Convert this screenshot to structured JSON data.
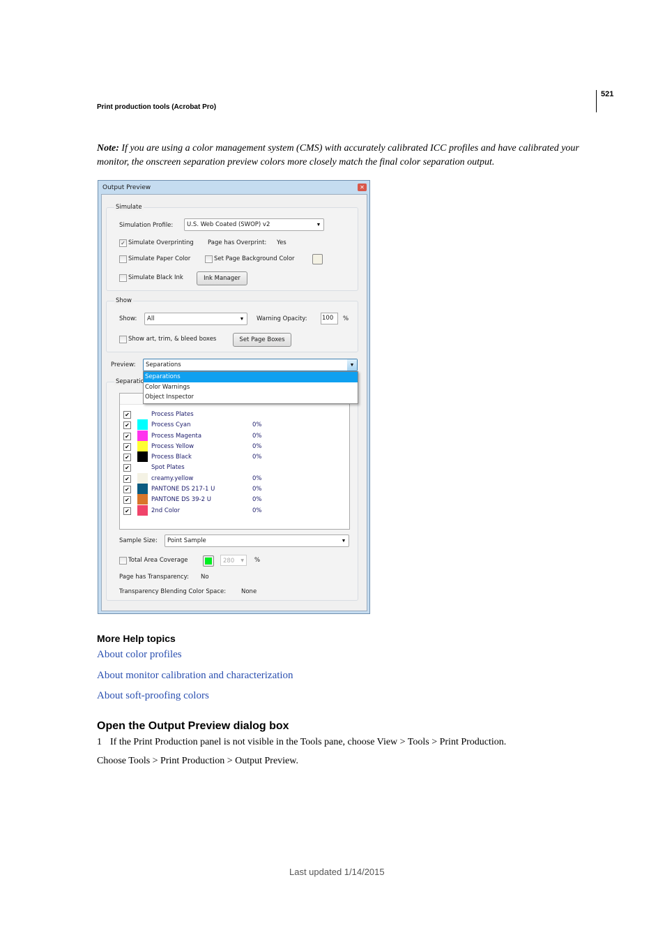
{
  "header": {
    "section": "Print production tools (Acrobat Pro)",
    "page_number": "521"
  },
  "note": {
    "label": "Note:",
    "text": " If you are using a color management system (CMS) with accurately calibrated ICC profiles and have calibrated your monitor, the onscreen separation preview colors more closely match the final color separation output."
  },
  "dialog": {
    "title": "Output Preview",
    "simulate": {
      "legend": "Simulate",
      "profile_label": "Simulation Profile:",
      "profile_value": "U.S. Web Coated (SWOP) v2",
      "overprinting": "Simulate Overprinting",
      "overprint_label": "Page has Overprint:",
      "overprint_value": "Yes",
      "paper_color": "Simulate Paper Color",
      "bg_color": "Set Page Background Color",
      "black_ink": "Simulate Black Ink",
      "ink_manager": "Ink Manager"
    },
    "show": {
      "legend": "Show",
      "show_label": "Show:",
      "show_value": "All",
      "opacity_label": "Warning Opacity:",
      "opacity_value": "100",
      "pct": "%",
      "boxes": "Show art, trim, & bleed boxes",
      "set_boxes": "Set Page Boxes"
    },
    "preview": {
      "label": "Preview:",
      "value": "Separations",
      "options": [
        "Separations",
        "Color Warnings",
        "Object Inspector"
      ],
      "selected": "Separations"
    },
    "separations": {
      "legend": "Separations",
      "rows": [
        {
          "name": "Process Plates",
          "color": null,
          "pct": ""
        },
        {
          "name": "Process Cyan",
          "color": "#00ffff",
          "pct": "0%"
        },
        {
          "name": "Process Magenta",
          "color": "#ff33ee",
          "pct": "0%"
        },
        {
          "name": "Process Yellow",
          "color": "#ffff33",
          "pct": "0%"
        },
        {
          "name": "Process Black",
          "color": "#000000",
          "pct": "0%"
        },
        {
          "name": "Spot Plates",
          "color": null,
          "pct": ""
        },
        {
          "name": "creamy.yellow",
          "color": "#f4f2e4",
          "pct": "0%"
        },
        {
          "name": "PANTONE DS 217-1 U",
          "color": "#0b5b80",
          "pct": "0%"
        },
        {
          "name": "PANTONE DS 39-2 U",
          "color": "#d9762a",
          "pct": "0%"
        },
        {
          "name": "2nd Color",
          "color": "#f0446a",
          "pct": "0%"
        }
      ]
    },
    "sample_label": "Sample Size:",
    "sample_value": "Point Sample",
    "tac_label": "Total Area Coverage",
    "tac_color": "#00ee22",
    "tac_value": "280",
    "tac_pct": "%",
    "transparency_label": "Page has Transparency:",
    "transparency_value": "No",
    "blend_label": "Transparency Blending Color Space:",
    "blend_value": "None"
  },
  "help": {
    "title": "More Help topics",
    "links": [
      "About color profiles",
      "About monitor calibration and characterization",
      "About soft-proofing colors"
    ]
  },
  "section2": {
    "title": "Open the Output Preview dialog box",
    "step_num": "1",
    "step_text": "If the Print Production panel is not visible in the Tools pane, choose View > Tools > Print Production.",
    "para": "Choose Tools > Print Production > Output Preview."
  },
  "footer": "Last updated 1/14/2015"
}
